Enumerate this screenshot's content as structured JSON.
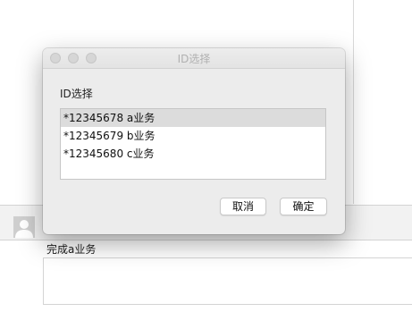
{
  "chat": {
    "message": "完成a业务"
  },
  "dialog": {
    "title": "ID选择",
    "label": "ID选择",
    "options": [
      "*12345678 a业务",
      "*12345679 b业务",
      "*12345680 c业务"
    ],
    "selected_index": 0,
    "cancel_label": "取消",
    "ok_label": "确定"
  },
  "icons": {
    "avatar": "default-user-avatar-icon"
  }
}
